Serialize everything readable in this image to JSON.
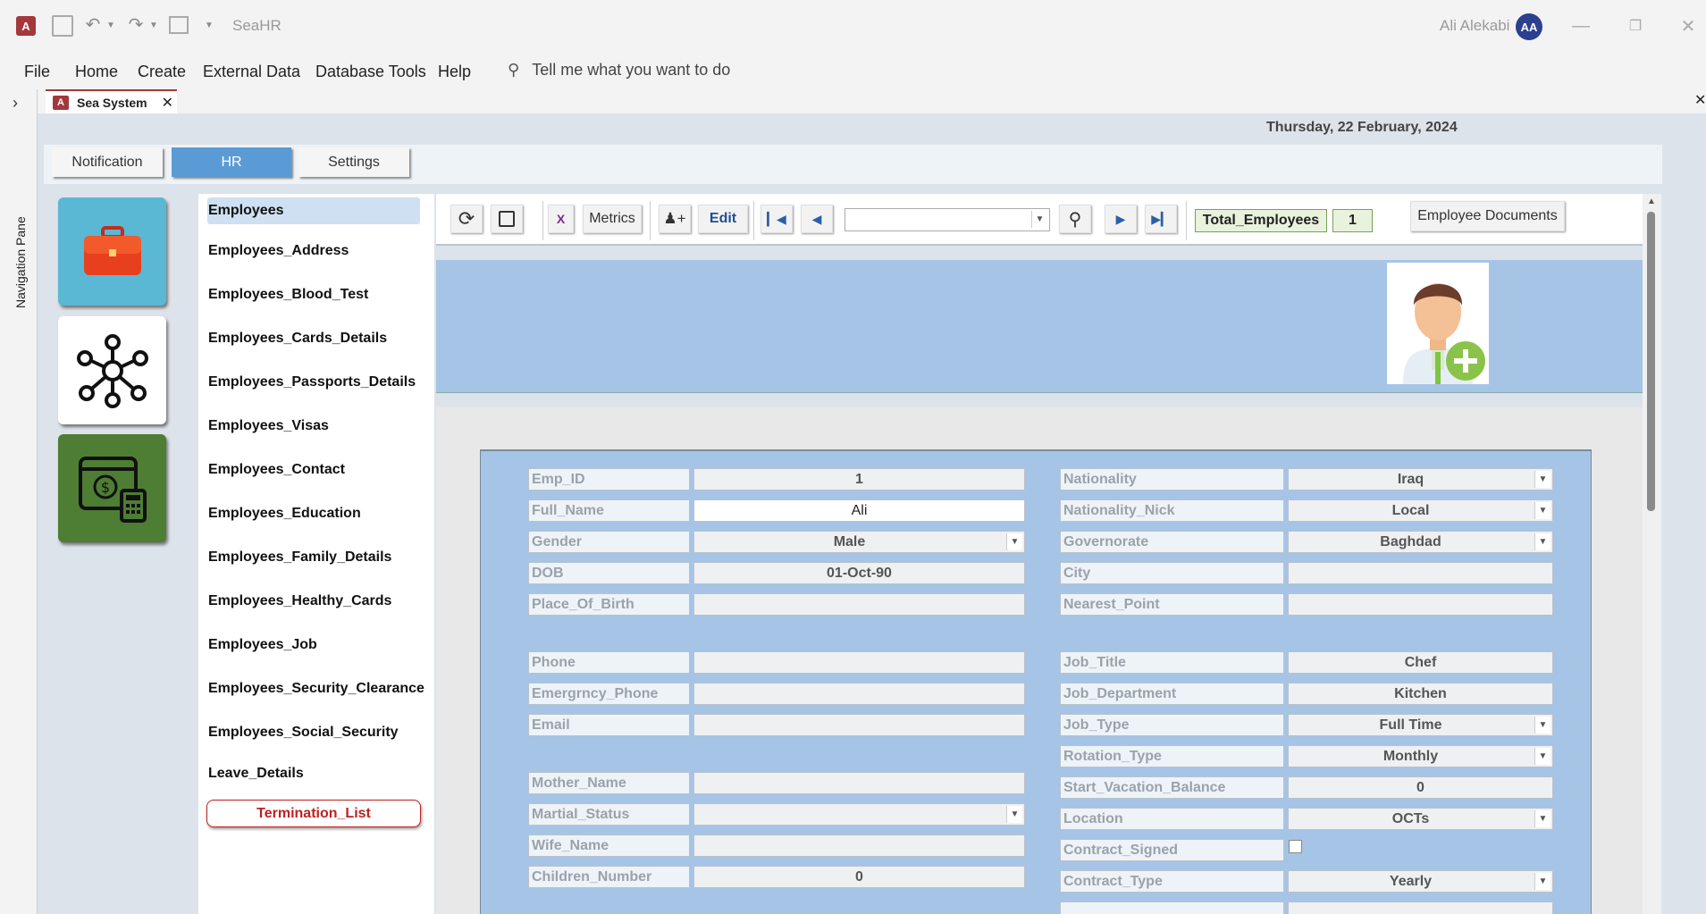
{
  "app": {
    "title": "SeaHR",
    "user_name": "Ali Alekabi",
    "user_initials": "AA"
  },
  "menu": {
    "items": [
      "File",
      "Home",
      "Create",
      "External Data",
      "Database Tools",
      "Help"
    ],
    "tell_me": "Tell me what you want to do"
  },
  "nav_pane": {
    "label": "Navigation Pane"
  },
  "doc_tab": {
    "label": "Sea System"
  },
  "form": {
    "date": "Thursday, 22 February, 2024",
    "top_tabs": [
      "Notification",
      "HR",
      "Settings"
    ],
    "active_tab": "HR",
    "side_tiles": [
      "briefcase-icon",
      "organization-network-icon",
      "payroll-calculator-icon"
    ],
    "subnav": {
      "items": [
        "Employees",
        "Employees_Address",
        "Employees_Blood_Test",
        "Employees_Cards_Details",
        "Employees_Passports_Details",
        "Employees_Visas",
        "Employees_Contact",
        "Employees_Education",
        "Employees_Family_Details",
        "Employees_Healthy_Cards",
        "Employees_Job",
        "Employees_Security_Clearance",
        "Employees_Social_Security",
        "Leave_Details"
      ],
      "termination": "Termination_List"
    },
    "toolbar": {
      "metrics": "Metrics",
      "edit": "Edit",
      "search_value": "",
      "total_label": "Total_Employees",
      "total_value": "1",
      "documents": "Employee Documents"
    },
    "left_fields": [
      {
        "label": "Emp_ID",
        "value": "1"
      },
      {
        "label": "Full_Name",
        "value": "Ali"
      },
      {
        "label": "Gender",
        "value": "Male"
      },
      {
        "label": "DOB",
        "value": "01-Oct-90"
      },
      {
        "label": "Place_Of_Birth",
        "value": ""
      },
      {
        "label": "Phone",
        "value": ""
      },
      {
        "label": "Emergrncy_Phone",
        "value": ""
      },
      {
        "label": "Email",
        "value": ""
      },
      {
        "label": "Mother_Name",
        "value": ""
      },
      {
        "label": "Martial_Status",
        "value": ""
      },
      {
        "label": "Wife_Name",
        "value": ""
      },
      {
        "label": "Children_Number",
        "value": "0"
      }
    ],
    "right_fields": [
      {
        "label": "Nationality",
        "value": "Iraq"
      },
      {
        "label": "Nationality_Nick",
        "value": "Local"
      },
      {
        "label": "Governorate",
        "value": "Baghdad"
      },
      {
        "label": "City",
        "value": ""
      },
      {
        "label": "Nearest_Point",
        "value": ""
      },
      {
        "label": "Job_Title",
        "value": "Chef"
      },
      {
        "label": "Job_Department",
        "value": "Kitchen"
      },
      {
        "label": "Job_Type",
        "value": "Full Time"
      },
      {
        "label": "Rotation_Type",
        "value": "Monthly"
      },
      {
        "label": "Start_Vacation_Balance",
        "value": "0"
      },
      {
        "label": "Location",
        "value": "OCTs"
      },
      {
        "label": "Contract_Signed",
        "value": ""
      },
      {
        "label": "Contract_Type",
        "value": "Yearly"
      }
    ]
  },
  "colors": {
    "accent": "#5b9bd5",
    "access_red": "#a4373a",
    "tile_blue": "#5ab8d4",
    "tile_green": "#4e7d34",
    "header_band": "#a6c4e6"
  }
}
